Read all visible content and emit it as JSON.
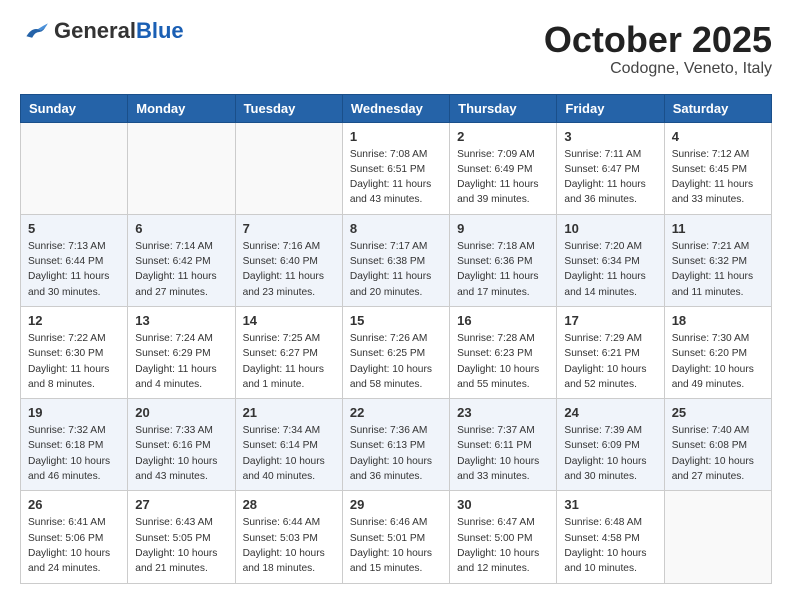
{
  "header": {
    "logo_general": "General",
    "logo_blue": "Blue",
    "title": "October 2025",
    "subtitle": "Codogne, Veneto, Italy"
  },
  "weekdays": [
    "Sunday",
    "Monday",
    "Tuesday",
    "Wednesday",
    "Thursday",
    "Friday",
    "Saturday"
  ],
  "weeks": [
    [
      {
        "day": "",
        "info": ""
      },
      {
        "day": "",
        "info": ""
      },
      {
        "day": "",
        "info": ""
      },
      {
        "day": "1",
        "info": "Sunrise: 7:08 AM\nSunset: 6:51 PM\nDaylight: 11 hours\nand 43 minutes."
      },
      {
        "day": "2",
        "info": "Sunrise: 7:09 AM\nSunset: 6:49 PM\nDaylight: 11 hours\nand 39 minutes."
      },
      {
        "day": "3",
        "info": "Sunrise: 7:11 AM\nSunset: 6:47 PM\nDaylight: 11 hours\nand 36 minutes."
      },
      {
        "day": "4",
        "info": "Sunrise: 7:12 AM\nSunset: 6:45 PM\nDaylight: 11 hours\nand 33 minutes."
      }
    ],
    [
      {
        "day": "5",
        "info": "Sunrise: 7:13 AM\nSunset: 6:44 PM\nDaylight: 11 hours\nand 30 minutes."
      },
      {
        "day": "6",
        "info": "Sunrise: 7:14 AM\nSunset: 6:42 PM\nDaylight: 11 hours\nand 27 minutes."
      },
      {
        "day": "7",
        "info": "Sunrise: 7:16 AM\nSunset: 6:40 PM\nDaylight: 11 hours\nand 23 minutes."
      },
      {
        "day": "8",
        "info": "Sunrise: 7:17 AM\nSunset: 6:38 PM\nDaylight: 11 hours\nand 20 minutes."
      },
      {
        "day": "9",
        "info": "Sunrise: 7:18 AM\nSunset: 6:36 PM\nDaylight: 11 hours\nand 17 minutes."
      },
      {
        "day": "10",
        "info": "Sunrise: 7:20 AM\nSunset: 6:34 PM\nDaylight: 11 hours\nand 14 minutes."
      },
      {
        "day": "11",
        "info": "Sunrise: 7:21 AM\nSunset: 6:32 PM\nDaylight: 11 hours\nand 11 minutes."
      }
    ],
    [
      {
        "day": "12",
        "info": "Sunrise: 7:22 AM\nSunset: 6:30 PM\nDaylight: 11 hours\nand 8 minutes."
      },
      {
        "day": "13",
        "info": "Sunrise: 7:24 AM\nSunset: 6:29 PM\nDaylight: 11 hours\nand 4 minutes."
      },
      {
        "day": "14",
        "info": "Sunrise: 7:25 AM\nSunset: 6:27 PM\nDaylight: 11 hours\nand 1 minute."
      },
      {
        "day": "15",
        "info": "Sunrise: 7:26 AM\nSunset: 6:25 PM\nDaylight: 10 hours\nand 58 minutes."
      },
      {
        "day": "16",
        "info": "Sunrise: 7:28 AM\nSunset: 6:23 PM\nDaylight: 10 hours\nand 55 minutes."
      },
      {
        "day": "17",
        "info": "Sunrise: 7:29 AM\nSunset: 6:21 PM\nDaylight: 10 hours\nand 52 minutes."
      },
      {
        "day": "18",
        "info": "Sunrise: 7:30 AM\nSunset: 6:20 PM\nDaylight: 10 hours\nand 49 minutes."
      }
    ],
    [
      {
        "day": "19",
        "info": "Sunrise: 7:32 AM\nSunset: 6:18 PM\nDaylight: 10 hours\nand 46 minutes."
      },
      {
        "day": "20",
        "info": "Sunrise: 7:33 AM\nSunset: 6:16 PM\nDaylight: 10 hours\nand 43 minutes."
      },
      {
        "day": "21",
        "info": "Sunrise: 7:34 AM\nSunset: 6:14 PM\nDaylight: 10 hours\nand 40 minutes."
      },
      {
        "day": "22",
        "info": "Sunrise: 7:36 AM\nSunset: 6:13 PM\nDaylight: 10 hours\nand 36 minutes."
      },
      {
        "day": "23",
        "info": "Sunrise: 7:37 AM\nSunset: 6:11 PM\nDaylight: 10 hours\nand 33 minutes."
      },
      {
        "day": "24",
        "info": "Sunrise: 7:39 AM\nSunset: 6:09 PM\nDaylight: 10 hours\nand 30 minutes."
      },
      {
        "day": "25",
        "info": "Sunrise: 7:40 AM\nSunset: 6:08 PM\nDaylight: 10 hours\nand 27 minutes."
      }
    ],
    [
      {
        "day": "26",
        "info": "Sunrise: 6:41 AM\nSunset: 5:06 PM\nDaylight: 10 hours\nand 24 minutes."
      },
      {
        "day": "27",
        "info": "Sunrise: 6:43 AM\nSunset: 5:05 PM\nDaylight: 10 hours\nand 21 minutes."
      },
      {
        "day": "28",
        "info": "Sunrise: 6:44 AM\nSunset: 5:03 PM\nDaylight: 10 hours\nand 18 minutes."
      },
      {
        "day": "29",
        "info": "Sunrise: 6:46 AM\nSunset: 5:01 PM\nDaylight: 10 hours\nand 15 minutes."
      },
      {
        "day": "30",
        "info": "Sunrise: 6:47 AM\nSunset: 5:00 PM\nDaylight: 10 hours\nand 12 minutes."
      },
      {
        "day": "31",
        "info": "Sunrise: 6:48 AM\nSunset: 4:58 PM\nDaylight: 10 hours\nand 10 minutes."
      },
      {
        "day": "",
        "info": ""
      }
    ]
  ]
}
